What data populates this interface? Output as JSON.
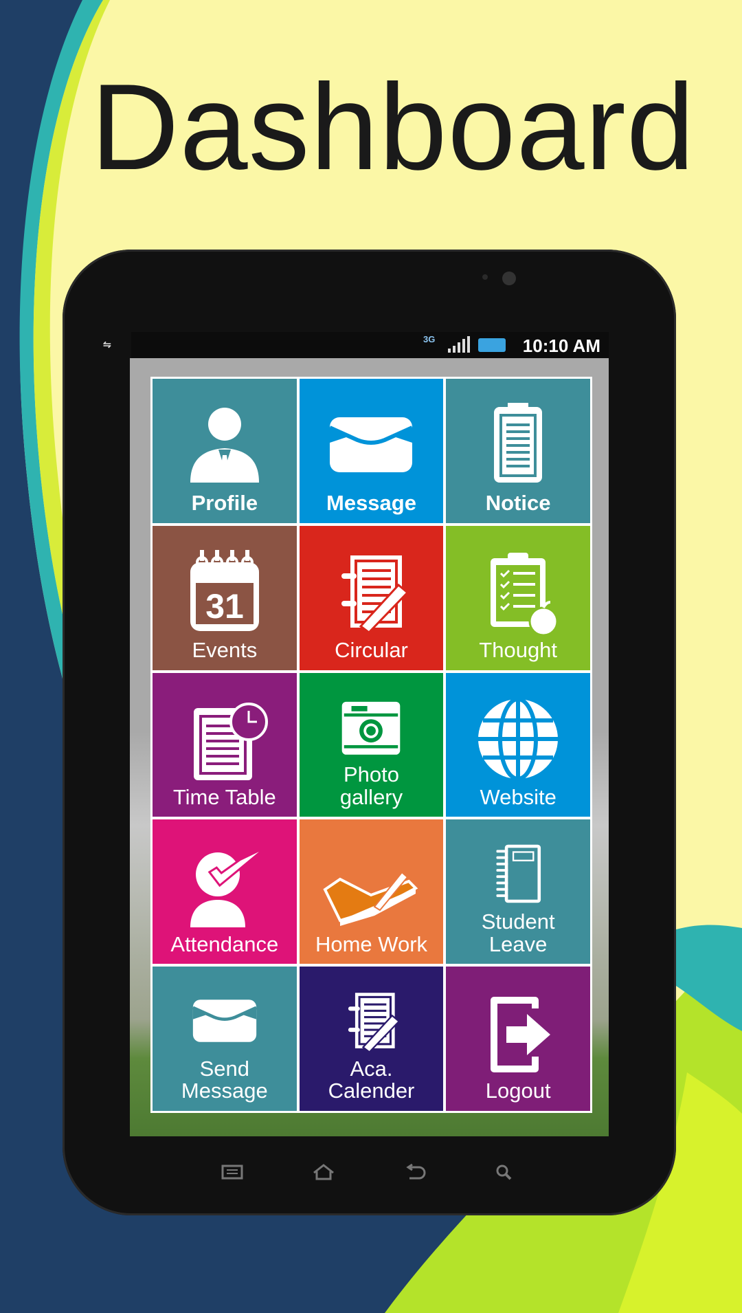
{
  "page_title": "Dashboard",
  "status_bar": {
    "time": "10:10 AM",
    "network": "3G"
  },
  "colors": {
    "background_yellow": "#fbf7a6",
    "background_navy": "#1f3f66",
    "swoosh_teal": "#2fb3b0",
    "swoosh_green": "#b4e32a"
  },
  "tiles": [
    {
      "label": "Profile",
      "icon": "person-icon",
      "color": "#3e8e9a",
      "bold": true
    },
    {
      "label": "Message",
      "icon": "envelope-icon",
      "color": "#0093d9",
      "bold": true
    },
    {
      "label": "Notice",
      "icon": "clipboard-icon",
      "color": "#3e8e9a",
      "bold": true
    },
    {
      "label": "Events",
      "icon": "calendar-icon",
      "color": "#8b5444",
      "calendar_day": "31"
    },
    {
      "label": "Circular",
      "icon": "notebook-pen-icon",
      "color": "#d9261c"
    },
    {
      "label": "Thought",
      "icon": "checklist-apple-icon",
      "color": "#84be26"
    },
    {
      "label": "Time Table",
      "icon": "schedule-clock-icon",
      "color": "#8a1d7b"
    },
    {
      "label": "Photo gallery",
      "icon": "camera-icon",
      "color": "#00963f"
    },
    {
      "label": "Website",
      "icon": "globe-icon",
      "color": "#0093d9"
    },
    {
      "label": "Attendance",
      "icon": "person-check-icon",
      "color": "#de1378"
    },
    {
      "label": "Home Work",
      "icon": "open-book-pen-icon",
      "color": "#e9783e"
    },
    {
      "label": "Student Leave",
      "icon": "spiral-notebook-icon",
      "color": "#3e8e9a"
    },
    {
      "label": "Send Message",
      "icon": "envelope-icon",
      "color": "#3e8e9a"
    },
    {
      "label": "Aca. Calender",
      "icon": "notebook-pen-icon",
      "color": "#2a1a6b"
    },
    {
      "label": "Logout",
      "icon": "logout-icon",
      "color": "#7f1e77"
    }
  ],
  "nav_buttons": [
    "menu",
    "home",
    "back",
    "search"
  ]
}
